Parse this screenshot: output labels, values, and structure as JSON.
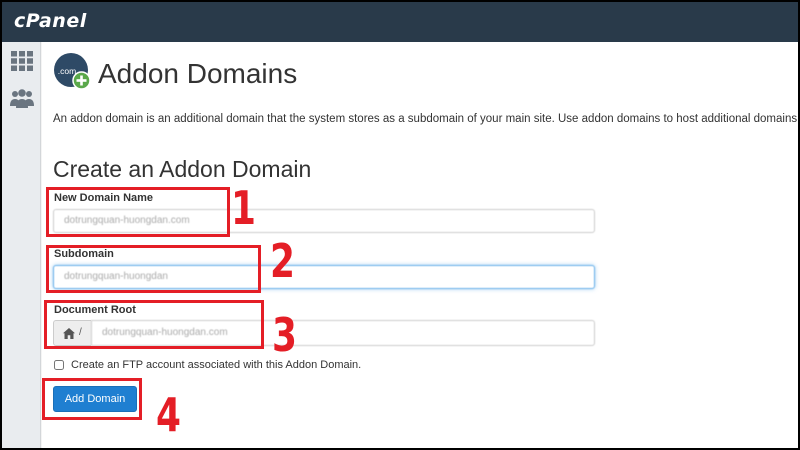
{
  "app": {
    "logo": "cPanel"
  },
  "sidebar": {
    "items": [
      {
        "icon": "grid-icon"
      },
      {
        "icon": "users-icon"
      }
    ]
  },
  "page": {
    "icon_text": ".com",
    "title": "Addon Domains",
    "description": "An addon domain is an additional domain that the system stores as a subdomain of your main site. Use addon domains to host additional domains",
    "section_heading": "Create an Addon Domain"
  },
  "form": {
    "new_domain": {
      "label": "New Domain Name",
      "value": "dotrungquan-huongdan.com"
    },
    "subdomain": {
      "label": "Subdomain",
      "value": "dotrungquan-huongdan"
    },
    "document_root": {
      "label": "Document Root",
      "prefix": "/",
      "prefix_icon": "home-icon",
      "value": "dotrungquan-huongdan.com"
    },
    "ftp_checkbox": {
      "label": "Create an FTP account associated with this Addon Domain.",
      "checked": false
    },
    "submit_label": "Add Domain"
  },
  "annotations": {
    "step_1": "1",
    "step_2": "2",
    "step_3": "3",
    "step_4": "4",
    "color": "#e41e26"
  },
  "colors": {
    "topbar": "#293a4a",
    "primary_button": "#1f7fd1",
    "focus_border": "#66afe9"
  }
}
